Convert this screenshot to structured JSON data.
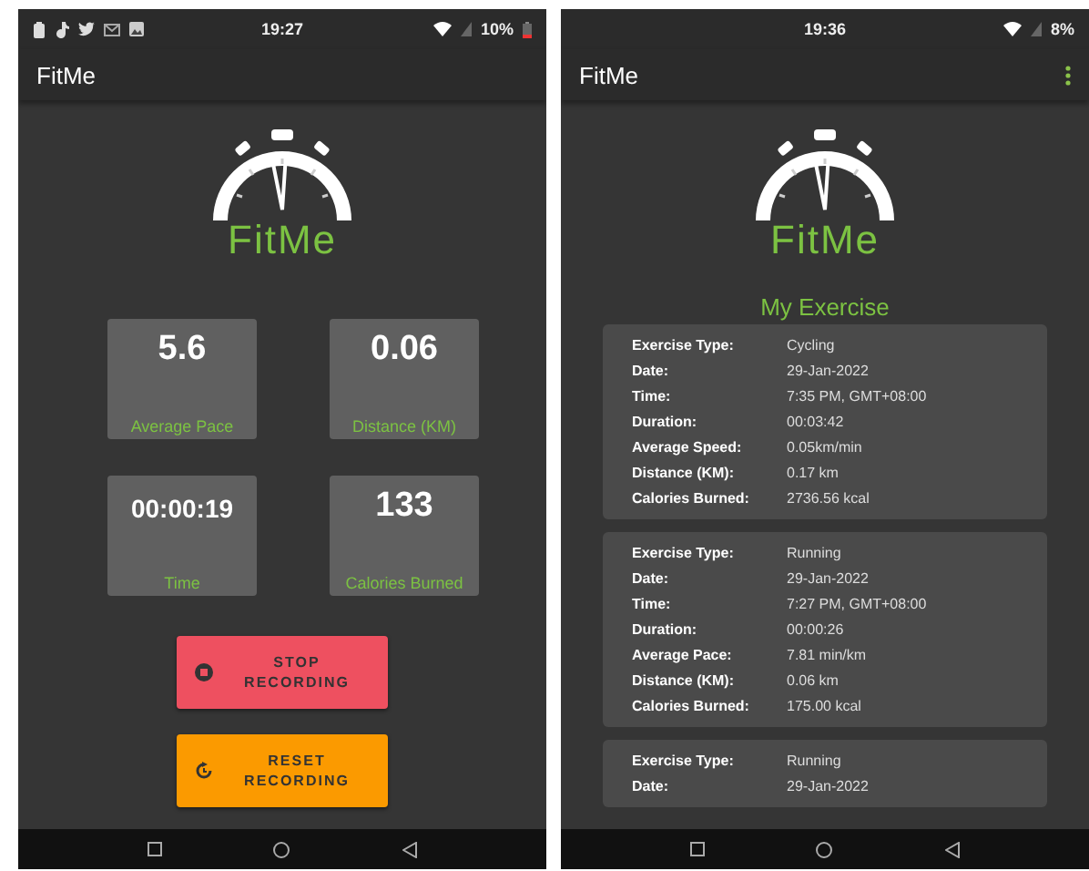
{
  "screens": [
    {
      "kind": "recording",
      "status_bar": {
        "notification_icons": [
          {
            "kind": "clipboard"
          },
          {
            "kind": "note"
          },
          {
            "kind": "bird"
          },
          {
            "kind": "mail"
          },
          {
            "kind": "image"
          }
        ],
        "time": "19:27",
        "battery": "10%",
        "battery_low": true
      },
      "app_bar": {
        "title": "FitMe",
        "menu": false
      },
      "logo": {
        "text": "FitMe"
      },
      "stats": [
        {
          "value": "5.6",
          "label": "Average Pace"
        },
        {
          "value": "0.06",
          "label": "Distance (KM)"
        },
        {
          "value": "00:00:19",
          "label": "Time"
        },
        {
          "value": "133",
          "label": "Calories Burned"
        }
      ],
      "buttons": [
        {
          "kind": "stop",
          "label": "STOP RECORDING"
        },
        {
          "kind": "reset",
          "label": "RESET RECORDING"
        }
      ]
    },
    {
      "kind": "history",
      "status_bar": {
        "time": "19:36",
        "battery": "8%",
        "battery_low": false
      },
      "app_bar": {
        "title": "FitMe",
        "menu": true
      },
      "logo": {
        "text": "FitMe"
      },
      "heading": "My Exercise",
      "cards": [
        {
          "rows": [
            {
              "label": "Exercise Type:",
              "value": "Cycling"
            },
            {
              "label": "Date:",
              "value": "29-Jan-2022"
            },
            {
              "label": "Time:",
              "value": "7:35 PM, GMT+08:00"
            },
            {
              "label": "Duration:",
              "value": "00:03:42"
            },
            {
              "label": "Average Speed:",
              "value": "0.05km/min"
            },
            {
              "label": "Distance (KM):",
              "value": "0.17 km"
            },
            {
              "label": "Calories Burned:",
              "value": "2736.56 kcal"
            }
          ]
        },
        {
          "rows": [
            {
              "label": "Exercise Type:",
              "value": "Running"
            },
            {
              "label": "Date:",
              "value": "29-Jan-2022"
            },
            {
              "label": "Time:",
              "value": "7:27 PM, GMT+08:00"
            },
            {
              "label": "Duration:",
              "value": "00:00:26"
            },
            {
              "label": "Average Pace:",
              "value": "7.81 min/km"
            },
            {
              "label": "Distance (KM):",
              "value": "0.06 km"
            },
            {
              "label": "Calories Burned:",
              "value": "175.00 kcal"
            }
          ]
        },
        {
          "rows": [
            {
              "label": "Exercise Type:",
              "value": "Running"
            },
            {
              "label": "Date:",
              "value": "29-Jan-2022"
            }
          ]
        }
      ]
    }
  ]
}
